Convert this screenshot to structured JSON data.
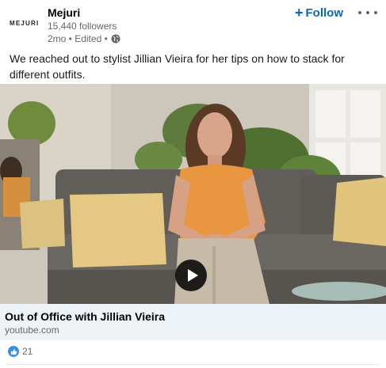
{
  "header": {
    "logo_text": "MEJURI",
    "company_name": "Mejuri",
    "followers": "15,440 followers",
    "meta": "2mo • Edited •",
    "follow_label": "Follow",
    "follow_plus": "+",
    "visibility_icon": "globe-icon",
    "more_icon": "more-dots-icon"
  },
  "post": {
    "text": "We reached out to stylist Jillian Vieira for her tips on how to stack for different outfits."
  },
  "video": {
    "play_icon": "play-icon"
  },
  "link": {
    "title": "Out of Office with Jillian Vieira",
    "domain": "youtube.com"
  },
  "reactions": {
    "icon": "like-icon",
    "count": "21"
  },
  "colors": {
    "accent": "#0a66c2",
    "like": "#378fe9",
    "link_bg": "#eef3f8"
  }
}
